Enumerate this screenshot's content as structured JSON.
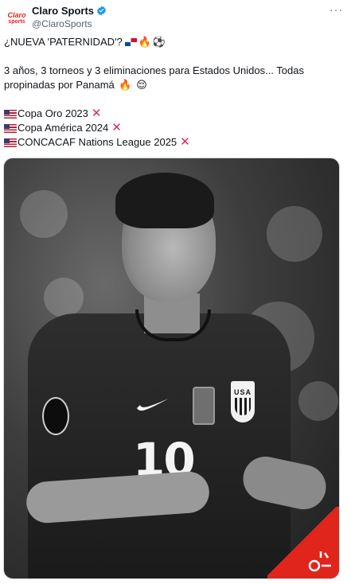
{
  "author": {
    "display_name": "Claro Sports",
    "handle": "@ClaroSports",
    "avatar_line1": "Claro",
    "avatar_line2": "sports",
    "verified_icon": "verified-badge-icon"
  },
  "more_icon": "···",
  "tweet": {
    "line1": "¿NUEVA 'PATERNIDAD'?",
    "line2": "3 años, 3 torneos y 3 eliminaciones para Estados Unidos... Todas propinadas por Panamá",
    "results": [
      {
        "text": "Copa Oro 2023"
      },
      {
        "text": "Copa América 2024"
      },
      {
        "text": "CONCACAF Nations League 2025"
      }
    ],
    "cross_mark": "✕"
  },
  "media": {
    "jersey_number": "10",
    "crest_text": "USA"
  },
  "colors": {
    "brand_red": "#e0261c",
    "text_primary": "#0f1419",
    "text_secondary": "#536471",
    "verified_blue": "#1d9bf0"
  }
}
